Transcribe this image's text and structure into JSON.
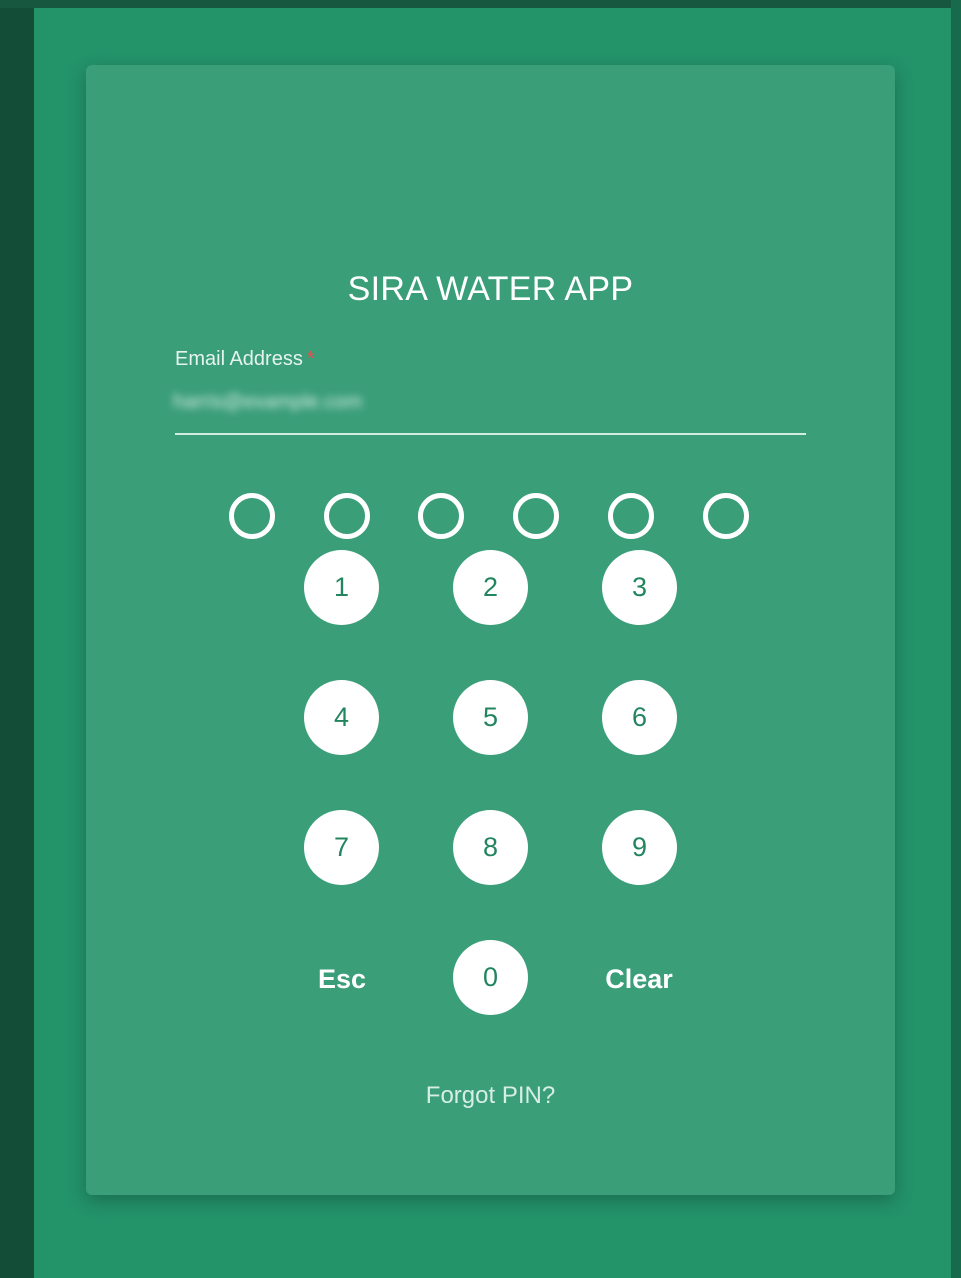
{
  "app": {
    "title": "SIRA WATER APP"
  },
  "email_field": {
    "label": "Email Address",
    "required_marker": "*",
    "value": "harris@example.com"
  },
  "pin": {
    "length": 6,
    "filled": 0
  },
  "keypad": {
    "key_1": "1",
    "key_2": "2",
    "key_3": "3",
    "key_4": "4",
    "key_5": "5",
    "key_6": "6",
    "key_7": "7",
    "key_8": "8",
    "key_9": "9",
    "key_0": "0",
    "esc_label": "Esc",
    "clear_label": "Clear"
  },
  "forgot_pin_label": "Forgot PIN?",
  "colors": {
    "page_background": "#23936a",
    "card_background": "#3a9e79",
    "key_text": "#23855f",
    "required": "#e85050"
  }
}
